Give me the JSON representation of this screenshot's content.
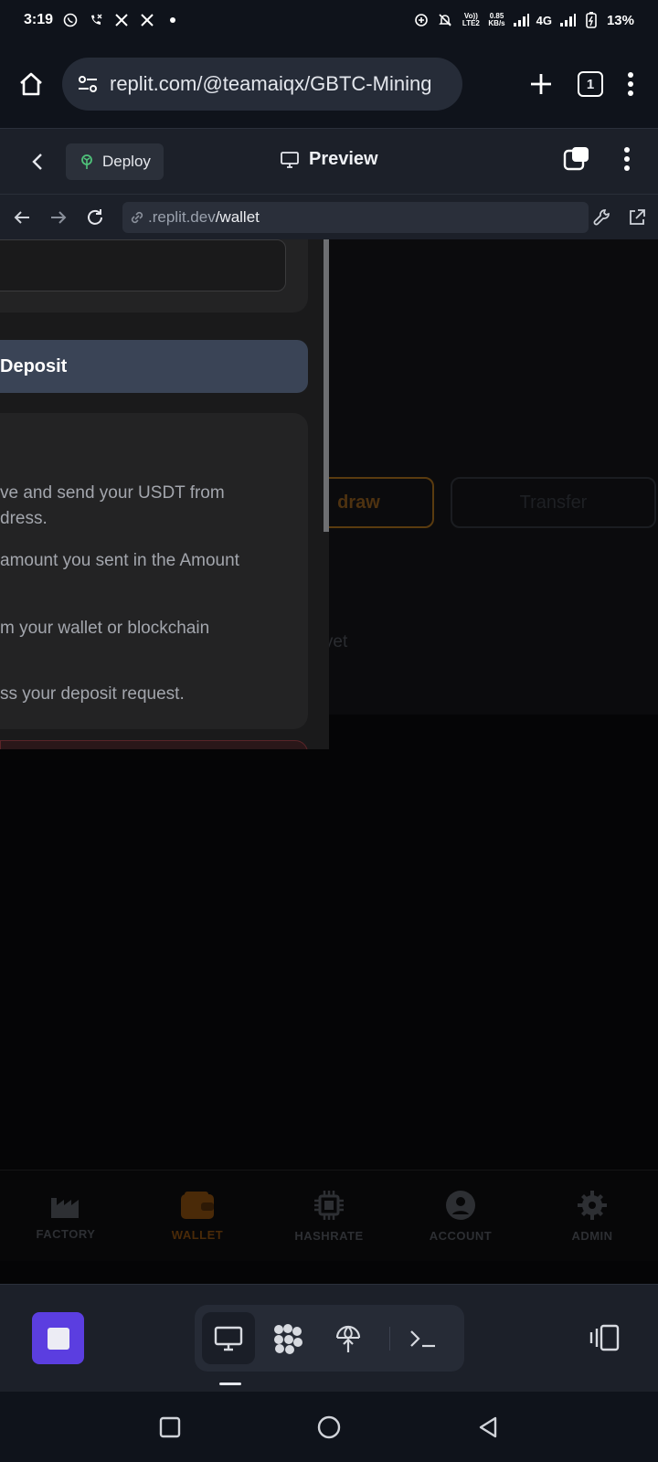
{
  "status_bar": {
    "time": "3:19",
    "left_icons": [
      "whatsapp-icon",
      "missed-call-icon",
      "x-icon",
      "x-icon",
      "dot-icon"
    ],
    "volte_label": "Vo)) LTE2",
    "speed": "0.85",
    "speed_unit": "KB/s",
    "network": "4G",
    "battery": "13%"
  },
  "browser": {
    "url": "replit.com/@teamaiqx/GBTC-Mining",
    "tab_count": "1"
  },
  "replit_header": {
    "deploy_label": "Deploy",
    "title": "Preview"
  },
  "webview": {
    "address_host": ".replit.dev",
    "address_path": "/wallet"
  },
  "page": {
    "deposit_button": "Deposit",
    "instructions": [
      "ve and send your USDT from",
      "dress.",
      "amount you sent in the Amount",
      "m your wallet or blockchain",
      "ss your deposit request."
    ],
    "withdraw_label": "draw",
    "transfer_label": "Transfer",
    "empty_transactions": "ctions yet",
    "bottom_nav": [
      {
        "label": "FACTORY",
        "icon": "factory-icon"
      },
      {
        "label": "WALLET",
        "icon": "wallet-icon",
        "active": true
      },
      {
        "label": "HASHRATE",
        "icon": "chip-icon"
      },
      {
        "label": "ACCOUNT",
        "icon": "account-icon"
      },
      {
        "label": "ADMIN",
        "icon": "gear-icon"
      }
    ]
  },
  "colors": {
    "accent_purple": "#5b3ee0",
    "deposit_button": "#3a4456",
    "wallet_active": "#4a2a08"
  }
}
